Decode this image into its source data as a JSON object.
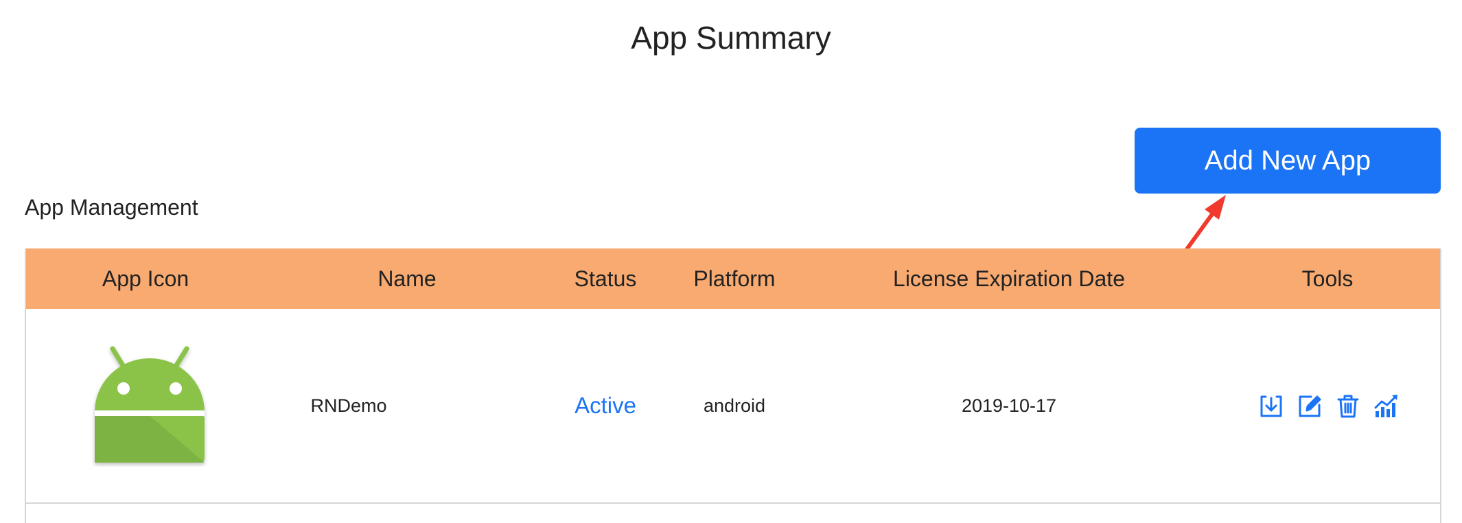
{
  "page": {
    "title": "App Summary"
  },
  "toolbar": {
    "add_label": "Add New App"
  },
  "section": {
    "title": "App Management"
  },
  "table": {
    "headers": [
      "App Icon",
      "Name",
      "Status",
      "Platform",
      "License Expiration Date",
      "Tools"
    ],
    "rows": [
      {
        "icon": "android-icon",
        "name": "RNDemo",
        "status": "Active",
        "platform": "android",
        "expiration": "2019-10-17"
      }
    ]
  },
  "tools": [
    "download-icon",
    "edit-icon",
    "delete-icon",
    "stats-icon"
  ],
  "colors": {
    "accent": "#1b74f5",
    "header_bg": "#f8aa70",
    "android_green": "#8bc34a",
    "arrow": "#f03a2e"
  }
}
